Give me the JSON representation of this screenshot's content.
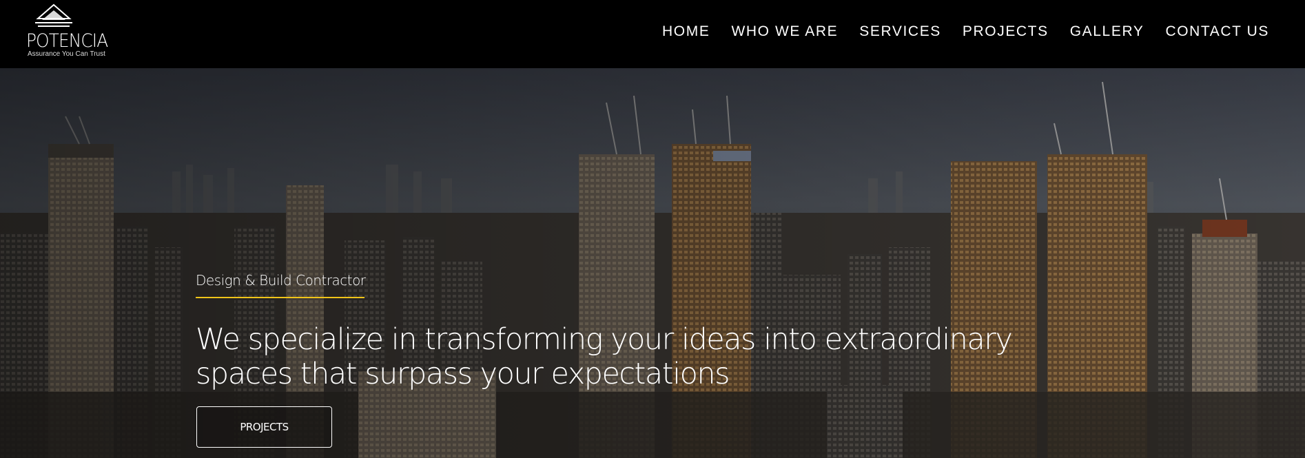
{
  "brand": {
    "name": "POTENCIA",
    "tagline": "Assurance You Can Trust"
  },
  "nav": {
    "items": [
      {
        "label": "HOME"
      },
      {
        "label": "WHO WE ARE"
      },
      {
        "label": "SERVICES"
      },
      {
        "label": "PROJECTS"
      },
      {
        "label": "GALLERY"
      },
      {
        "label": "CONTACT US"
      }
    ]
  },
  "hero": {
    "kicker": "Design & Build Contractor",
    "headline": "We specialize in transforming your ideas into extraordinary spaces that surpass your expectations",
    "cta_label": "PROJECTS"
  },
  "colors": {
    "topbar": "#000000",
    "accent_line": "#f0c419",
    "text": "#ffffff"
  }
}
